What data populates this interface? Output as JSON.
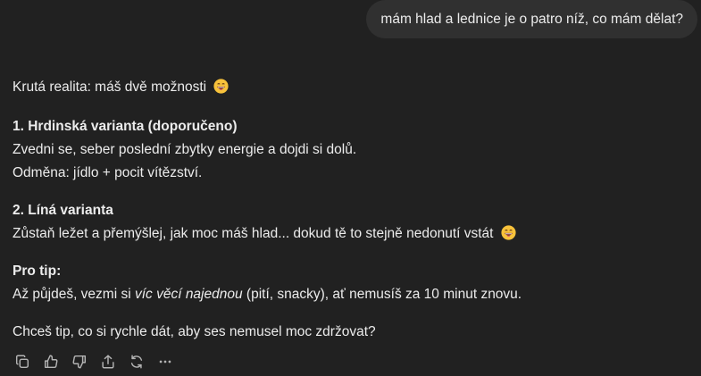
{
  "user_message": "mám hlad a lednice je o patro níž, co mám dělat?",
  "assistant": {
    "intro": "Krutá realita: máš dvě možnosti",
    "option1": {
      "title": "1. Hrdinská varianta (doporučeno)",
      "line1": "Zvedni se, seber poslední zbytky energie a dojdi si dolů.",
      "line2": "Odměna: jídlo + pocit vítězství."
    },
    "option2": {
      "title": "2. Líná varianta",
      "line1": "Zůstaň ležet a přemýšlej, jak moc máš hlad... dokud tě to stejně nedonutí vstát"
    },
    "protip": {
      "title": "Pro tip:",
      "before": "Až půjdeš, vezmi si ",
      "italic": "víc věcí najednou",
      "after": " (pití, snacky), ať nemusíš za 10 minut znovu."
    },
    "question": "Chceš tip, co si rychle dát, aby ses nemusel moc zdržovat?"
  },
  "actions": [
    "copy-icon",
    "thumbs-up-icon",
    "thumbs-down-icon",
    "share-icon",
    "regenerate-icon",
    "more-icon"
  ],
  "colors": {
    "background": "#212121",
    "bubble": "#303030",
    "text": "#ececec",
    "icon": "#b4b4b4",
    "emoji": "#f7c23b"
  }
}
